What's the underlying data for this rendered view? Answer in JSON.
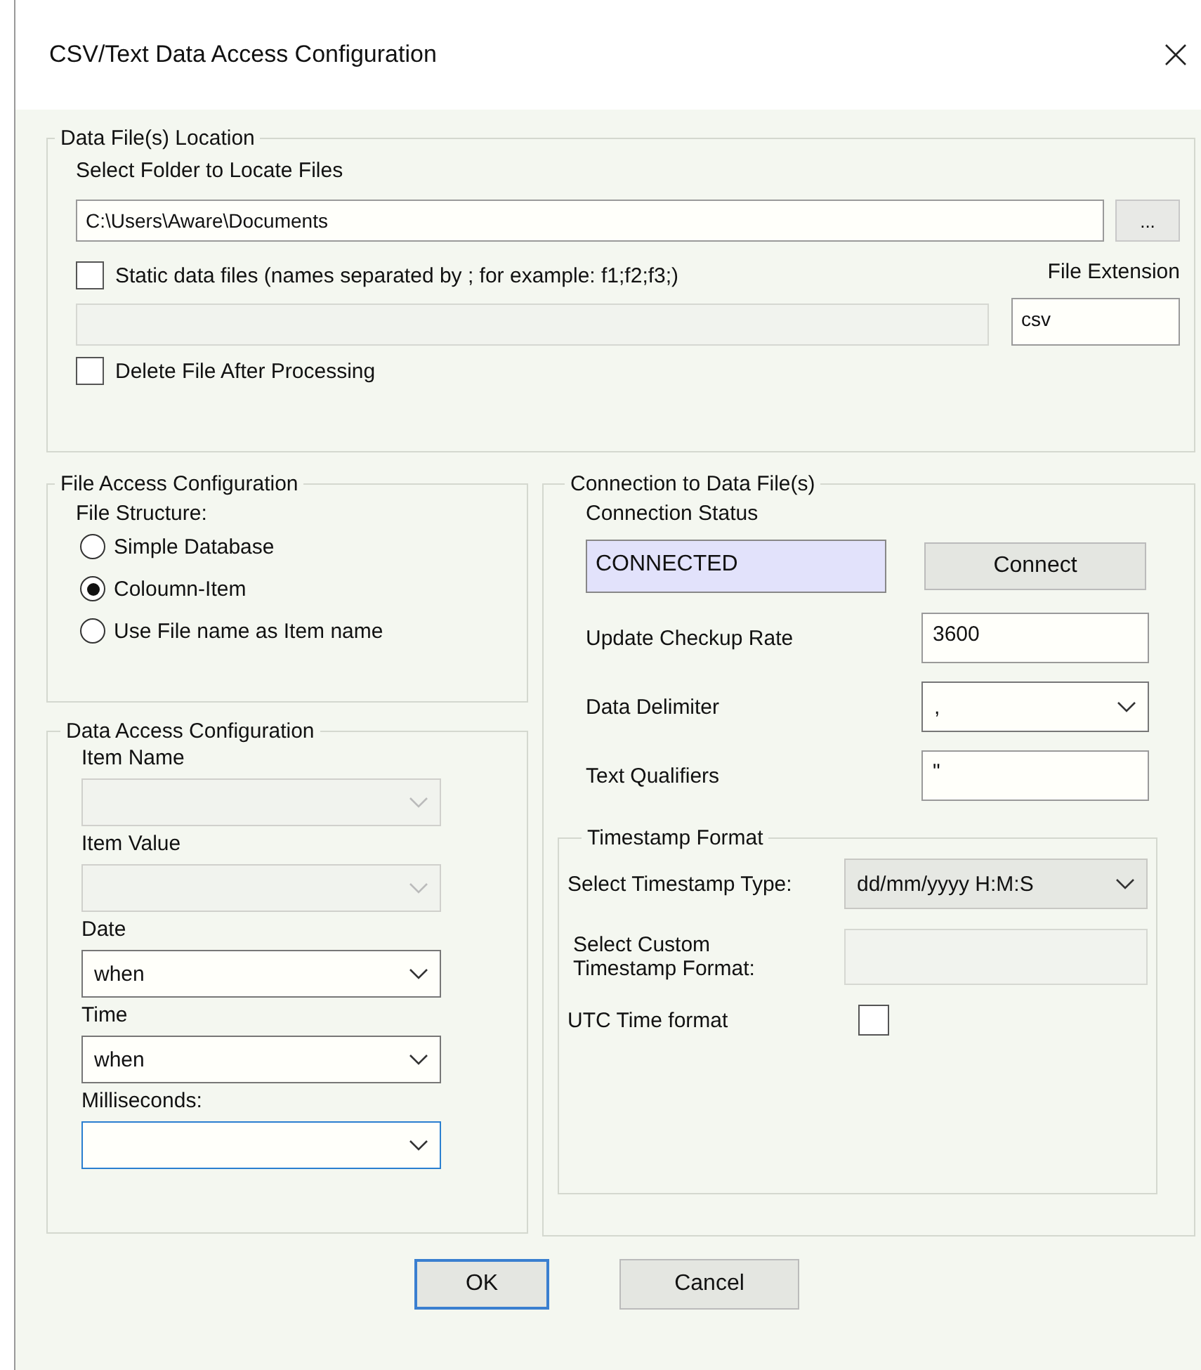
{
  "window": {
    "title": "CSV/Text Data Access Configuration"
  },
  "data_file_location": {
    "legend": "Data File(s) Location",
    "folder_label": "Select Folder to Locate Files",
    "folder_path": "C:\\Users\\Aware\\Documents",
    "browse_button": "...",
    "static_files": {
      "label": "Static data files (names separated by ; for example: f1;f2;f3;)",
      "checked": false
    },
    "static_files_field": {
      "disabled": true
    },
    "file_extension_label": "File Extension",
    "file_extension": "csv",
    "delete_after": {
      "label": "Delete File After Processing",
      "checked": false
    }
  },
  "file_access": {
    "legend": "File Access Configuration",
    "structure_label": "File Structure:",
    "options": [
      {
        "label": "Simple Database",
        "selected": false
      },
      {
        "label": "Coloumn-Item",
        "selected": true
      },
      {
        "label": "Use File name as Item name",
        "selected": false
      }
    ]
  },
  "data_access": {
    "legend": "Data Access Configuration",
    "fields": [
      {
        "label": "Item Name",
        "disabled": true,
        "focused": false
      },
      {
        "label": "Item Value",
        "disabled": true,
        "focused": false
      },
      {
        "label": "Date",
        "value": "when",
        "disabled": false,
        "focused": false
      },
      {
        "label": "Time",
        "value": "when",
        "disabled": false,
        "focused": false
      },
      {
        "label": "Milliseconds:",
        "disabled": false,
        "focused": true
      }
    ]
  },
  "connection": {
    "legend": "Connection to Data File(s)",
    "status_label": "Connection Status",
    "status": "CONNECTED",
    "connect_button": "Connect",
    "rows": [
      {
        "label": "Update Checkup Rate",
        "kind": "text",
        "value": "3600"
      },
      {
        "label": "Data Delimiter",
        "kind": "dropdown",
        "value": ","
      },
      {
        "label": "Text Qualifiers",
        "kind": "text",
        "value": "\""
      }
    ],
    "timestamp": {
      "legend": "Timestamp Format",
      "type_label": "Select Timestamp Type:",
      "type_value": "dd/mm/yyyy H:M:S",
      "custom_label": "Select Custom Timestamp Format:",
      "custom_field": {
        "disabled": true
      },
      "utc_label": "UTC Time format",
      "utc_checked": false
    }
  },
  "buttons": [
    {
      "label": "OK",
      "default": true
    },
    {
      "label": "Cancel",
      "default": false
    }
  ]
}
